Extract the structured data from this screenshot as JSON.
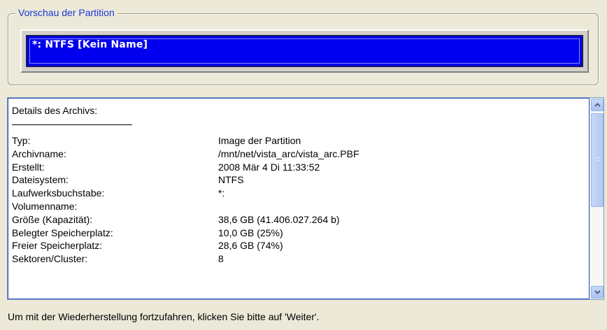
{
  "preview": {
    "legend": "Vorschau der Partition",
    "partition_label": "*: NTFS [Kein Name]",
    "bar_color": "#0000ee"
  },
  "details": {
    "title": "Details des Archivs:",
    "rows": [
      {
        "label": "Typ:",
        "value": "Image der Partition"
      },
      {
        "label": "Archivname:",
        "value": "/mnt/net/vista_arc/vista_arc.PBF"
      },
      {
        "label": "Erstellt:",
        "value": "2008 Mär 4 Di 11:33:52"
      },
      {
        "label": "Dateisystem:",
        "value": "NTFS"
      },
      {
        "label": "Laufwerksbuchstabe:",
        "value": "*:"
      },
      {
        "label": "Volumenname:",
        "value": ""
      },
      {
        "label": "Größe (Kapazität):",
        "value": "38,6 GB (41.406.027.264 b)"
      },
      {
        "label": "Belegter Speicherplatz:",
        "value": "10,0 GB (25%)"
      },
      {
        "label": "Freier Speicherplatz:",
        "value": "28,6 GB (74%)"
      },
      {
        "label": "Sektoren/Cluster:",
        "value": "8"
      }
    ],
    "scrollbar": {
      "up_icon": "chevron-up-icon",
      "down_icon": "chevron-down-icon"
    }
  },
  "status": {
    "text": "Um mit der Wiederherstellung fortzufahren, klicken Sie bitte auf 'Weiter'."
  }
}
